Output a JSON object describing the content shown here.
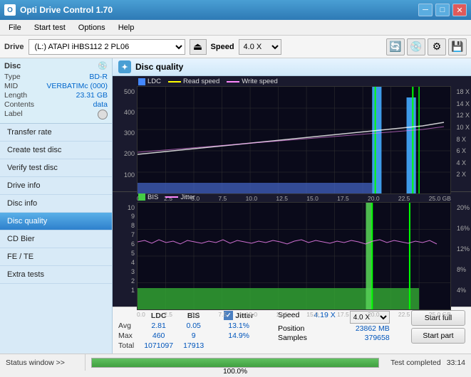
{
  "titleBar": {
    "title": "Opti Drive Control 1.70",
    "minimize": "─",
    "maximize": "□",
    "close": "✕"
  },
  "menu": {
    "items": [
      "File",
      "Start test",
      "Options",
      "Help"
    ]
  },
  "toolbar": {
    "driveLabel": "Drive",
    "driveValue": "(L:)  ATAPI iHBS112  2 PL06",
    "speedLabel": "Speed",
    "speedValue": "4.0 X"
  },
  "discInfo": {
    "title": "Disc",
    "rows": [
      {
        "key": "Type",
        "val": "BD-R"
      },
      {
        "key": "MID",
        "val": "VERBATIMc (000)"
      },
      {
        "key": "Length",
        "val": "23.31 GB"
      },
      {
        "key": "Contents",
        "val": "data"
      },
      {
        "key": "Label",
        "val": ""
      }
    ]
  },
  "navigation": {
    "items": [
      {
        "id": "transfer-rate",
        "label": "Transfer rate"
      },
      {
        "id": "create-test-disc",
        "label": "Create test disc"
      },
      {
        "id": "verify-test-disc",
        "label": "Verify test disc"
      },
      {
        "id": "drive-info",
        "label": "Drive info"
      },
      {
        "id": "disc-info",
        "label": "Disc info"
      },
      {
        "id": "disc-quality",
        "label": "Disc quality",
        "active": true
      },
      {
        "id": "cd-bier",
        "label": "CD Bier"
      },
      {
        "id": "fe-te",
        "label": "FE / TE"
      },
      {
        "id": "extra-tests",
        "label": "Extra tests"
      }
    ]
  },
  "discQuality": {
    "title": "Disc quality",
    "chart1": {
      "legend": [
        {
          "label": "LDC",
          "color": "#4488ff",
          "type": "sq"
        },
        {
          "label": "Read speed",
          "color": "#ffff00",
          "type": "line"
        },
        {
          "label": "Write speed",
          "color": "#ff88ff",
          "type": "line"
        }
      ],
      "yLabels": [
        "500",
        "400",
        "300",
        "200",
        "100"
      ],
      "yLabelsRight": [
        "18 X",
        "14 X",
        "12 X",
        "10 X",
        "8 X",
        "6 X",
        "4 X",
        "2 X"
      ],
      "xLabels": [
        "0.0",
        "2.5",
        "5.0",
        "7.5",
        "10.0",
        "12.5",
        "15.0",
        "17.5",
        "20.0",
        "22.5",
        "25.0 GB"
      ]
    },
    "chart2": {
      "legend": [
        {
          "label": "BIS",
          "color": "#44cc44",
          "type": "sq"
        },
        {
          "label": "Jitter",
          "color": "#ff88ff",
          "type": "line"
        }
      ],
      "yLabels": [
        "10",
        "9",
        "8",
        "7",
        "6",
        "5",
        "4",
        "3",
        "2",
        "1"
      ],
      "yLabelsRight": [
        "20%",
        "16%",
        "12%",
        "8%",
        "4%"
      ],
      "xLabels": [
        "0.0",
        "2.5",
        "5.0",
        "7.5",
        "10.0",
        "12.5",
        "15.0",
        "17.5",
        "20.0",
        "22.5",
        "25.0 GB"
      ]
    }
  },
  "stats": {
    "columns": [
      "",
      "LDC",
      "BIS",
      "",
      "Jitter",
      "Speed",
      ""
    ],
    "rows": [
      {
        "label": "Avg",
        "ldc": "2.81",
        "bis": "0.05",
        "jitter": "13.1%",
        "speed": "",
        "position": ""
      },
      {
        "label": "Max",
        "ldc": "460",
        "bis": "9",
        "jitter": "14.9%",
        "speed": "4.19 X",
        "speedSelect": "4.0 X",
        "position": "23862 MB"
      },
      {
        "label": "Total",
        "ldc": "1071097",
        "bis": "17913",
        "jitter": "",
        "speed": "",
        "samples": "379658"
      }
    ],
    "jitterLabel": "Jitter",
    "speedLabel": "Speed",
    "speedValue": "4.19 X",
    "speedSelectValue": "4.0 X",
    "positionLabel": "Position",
    "positionValue": "23862 MB",
    "samplesLabel": "Samples",
    "samplesValue": "379658",
    "buttons": {
      "startFull": "Start full",
      "startPart": "Start part"
    }
  },
  "statusBar": {
    "windowLabel": "Status window >>",
    "progressValue": 100,
    "progressText": "100.0%",
    "statusText": "Test completed",
    "time": "33:14"
  }
}
